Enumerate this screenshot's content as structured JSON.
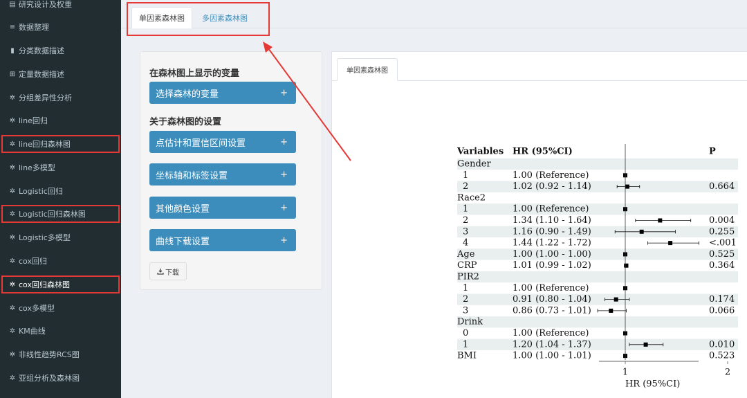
{
  "sidebar": {
    "items": [
      {
        "label": "研究设计及权重",
        "icon": "▤",
        "icon_name": "table-icon"
      },
      {
        "label": "数据整理",
        "icon": "≡",
        "icon_name": "database-icon"
      },
      {
        "label": "分类数据描述",
        "icon": "▮",
        "icon_name": "bar-chart-icon"
      },
      {
        "label": "定量数据描述",
        "icon": "⊞",
        "icon_name": "table-icon"
      },
      {
        "label": "分组差异性分析",
        "icon": "✲",
        "icon_name": "gear-icon"
      },
      {
        "label": "line回归",
        "icon": "✲",
        "icon_name": "gear-icon"
      },
      {
        "label": "line回归森林图",
        "icon": "✲",
        "icon_name": "gear-icon"
      },
      {
        "label": "line多模型",
        "icon": "✲",
        "icon_name": "gear-icon"
      },
      {
        "label": "Logistic回归",
        "icon": "✲",
        "icon_name": "gear-icon"
      },
      {
        "label": "Logistic回归森林图",
        "icon": "✲",
        "icon_name": "gear-icon"
      },
      {
        "label": "Logistic多模型",
        "icon": "✲",
        "icon_name": "gear-icon"
      },
      {
        "label": "cox回归",
        "icon": "✲",
        "icon_name": "gear-icon"
      },
      {
        "label": "cox回归森林图",
        "icon": "✲",
        "icon_name": "gear-icon"
      },
      {
        "label": "cox多模型",
        "icon": "✲",
        "icon_name": "gear-icon"
      },
      {
        "label": "KM曲线",
        "icon": "✲",
        "icon_name": "gear-icon"
      },
      {
        "label": "非线性趋势RCS图",
        "icon": "✲",
        "icon_name": "gear-icon"
      },
      {
        "label": "亚组分析及森林图",
        "icon": "✲",
        "icon_name": "gear-icon"
      }
    ]
  },
  "top_tabs": {
    "single": "单因素森林图",
    "multi": "多因素森林图"
  },
  "settings": {
    "section1_title": "在森林图上显示的变量",
    "section2_title": "关于森林图的设置",
    "buttons": [
      "选择森林的变量",
      "点估计和置信区间设置",
      "坐标轴和标签设置",
      "其他颜色设置",
      "曲线下载设置"
    ],
    "plus": "+",
    "download_label": "下载"
  },
  "plot_tab": {
    "label": "单因素森林图"
  },
  "forest": {
    "headers": {
      "variables": "Variables",
      "hr": "HR (95%CI)",
      "p": "P"
    },
    "x_axis": {
      "ticks": [
        {
          "value": 1,
          "label": "1"
        },
        {
          "value": 2,
          "label": "2"
        }
      ],
      "label": "HR (95%CI)",
      "reference_line": 1
    },
    "rows": [
      {
        "label": "Gender",
        "indent": false,
        "hr_text": "",
        "p": "",
        "point": null
      },
      {
        "label": "1",
        "indent": true,
        "hr_text": "1.00 (Reference)",
        "p": "",
        "point": {
          "hr": 1.0,
          "lo": 1.0,
          "hi": 1.0
        }
      },
      {
        "label": "2",
        "indent": true,
        "hr_text": "1.02 (0.92 - 1.14)",
        "p": "0.664",
        "point": {
          "hr": 1.02,
          "lo": 0.92,
          "hi": 1.14
        }
      },
      {
        "label": "Race2",
        "indent": false,
        "hr_text": "",
        "p": "",
        "point": null
      },
      {
        "label": "1",
        "indent": true,
        "hr_text": "1.00 (Reference)",
        "p": "",
        "point": {
          "hr": 1.0,
          "lo": 1.0,
          "hi": 1.0
        }
      },
      {
        "label": "2",
        "indent": true,
        "hr_text": "1.34 (1.10 - 1.64)",
        "p": "0.004",
        "point": {
          "hr": 1.34,
          "lo": 1.1,
          "hi": 1.64
        }
      },
      {
        "label": "3",
        "indent": true,
        "hr_text": "1.16 (0.90 - 1.49)",
        "p": "0.255",
        "point": {
          "hr": 1.16,
          "lo": 0.9,
          "hi": 1.49
        }
      },
      {
        "label": "4",
        "indent": true,
        "hr_text": "1.44 (1.22 - 1.72)",
        "p": "<.001",
        "point": {
          "hr": 1.44,
          "lo": 1.22,
          "hi": 1.72
        }
      },
      {
        "label": "Age",
        "indent": false,
        "hr_text": "1.00 (1.00 - 1.00)",
        "p": "0.525",
        "point": {
          "hr": 1.0,
          "lo": 1.0,
          "hi": 1.0
        }
      },
      {
        "label": "CRP",
        "indent": false,
        "hr_text": "1.01 (0.99 - 1.02)",
        "p": "0.364",
        "point": {
          "hr": 1.01,
          "lo": 0.99,
          "hi": 1.02
        }
      },
      {
        "label": "PIR2",
        "indent": false,
        "hr_text": "",
        "p": "",
        "point": null
      },
      {
        "label": "1",
        "indent": true,
        "hr_text": "1.00 (Reference)",
        "p": "",
        "point": {
          "hr": 1.0,
          "lo": 1.0,
          "hi": 1.0
        }
      },
      {
        "label": "2",
        "indent": true,
        "hr_text": "0.91 (0.80 - 1.04)",
        "p": "0.174",
        "point": {
          "hr": 0.91,
          "lo": 0.8,
          "hi": 1.04
        }
      },
      {
        "label": "3",
        "indent": true,
        "hr_text": "0.86 (0.73 - 1.01)",
        "p": "0.066",
        "point": {
          "hr": 0.86,
          "lo": 0.73,
          "hi": 1.01
        }
      },
      {
        "label": "Drink",
        "indent": false,
        "hr_text": "",
        "p": "",
        "point": null
      },
      {
        "label": "0",
        "indent": true,
        "hr_text": "1.00 (Reference)",
        "p": "",
        "point": {
          "hr": 1.0,
          "lo": 1.0,
          "hi": 1.0
        }
      },
      {
        "label": "1",
        "indent": true,
        "hr_text": "1.20 (1.04 - 1.37)",
        "p": "0.010",
        "point": {
          "hr": 1.2,
          "lo": 1.04,
          "hi": 1.37
        }
      },
      {
        "label": "BMI",
        "indent": false,
        "hr_text": "1.00 (1.00 - 1.01)",
        "p": "0.523",
        "point": {
          "hr": 1.0,
          "lo": 1.0,
          "hi": 1.01
        }
      }
    ]
  },
  "colors": {
    "sidebar_bg": "#222d32",
    "accent": "#3c8dbc",
    "highlight": "#e53935",
    "row_shade": "#e8efee"
  }
}
